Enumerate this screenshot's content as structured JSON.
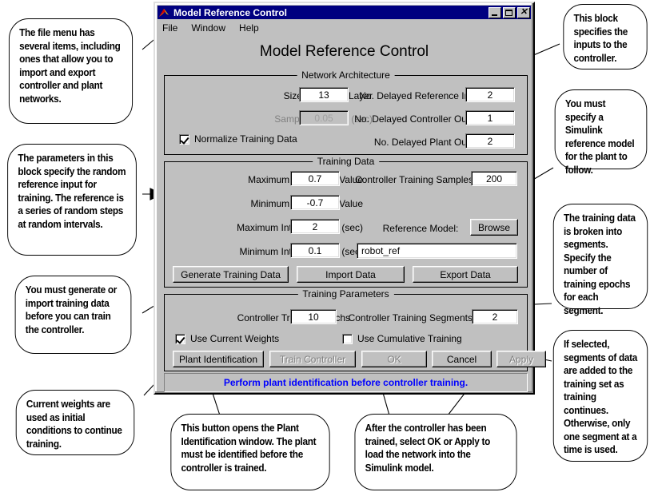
{
  "window": {
    "title": "Model Reference Control",
    "icon": "matlab-membrane-icon",
    "minimize_label": "",
    "maximize_label": "",
    "close_label": "✕",
    "menu": [
      {
        "label": "File"
      },
      {
        "label": "Window"
      },
      {
        "label": "Help"
      }
    ],
    "heading": "Model Reference Control",
    "status_message": "Perform plant identification before controller training.",
    "status_color": "#0000ff"
  },
  "network_architecture": {
    "title": "Network Architecture",
    "size_hidden_layer_label": "Size of Hidden Layer",
    "size_hidden_layer_value": "13",
    "sampling_interval_label": "Sampling Interval (sec)",
    "sampling_interval_value": "0.05",
    "normalize_label": "Normalize Training Data",
    "normalize_checked": true,
    "delayed_reference_inputs_label": "No. Delayed Reference Inputs",
    "delayed_reference_inputs_value": "2",
    "delayed_controller_outputs_label": "No. Delayed Controller Outputs",
    "delayed_controller_outputs_value": "1",
    "delayed_plant_outputs_label": "No. Delayed Plant Outputs",
    "delayed_plant_outputs_value": "2"
  },
  "training_data": {
    "title": "Training Data",
    "max_reference_label": "Maximum Reference Value",
    "max_reference_value": "0.7",
    "min_reference_label": "Minimum Reference Value",
    "min_reference_value": "-0.7",
    "max_interval_label": "Maximum Interval Value (sec)",
    "max_interval_value": "2",
    "min_interval_label": "Minimum Interval Value (sec)",
    "min_interval_value": "0.1",
    "controller_training_samples_label": "Controller Training Samples",
    "controller_training_samples_value": "200",
    "reference_model_label": "Reference Model:",
    "reference_model_value": "robot_ref",
    "browse_label": "Browse",
    "generate_label": "Generate Training Data",
    "import_label": "Import Data",
    "export_label": "Export Data"
  },
  "training_parameters": {
    "title": "Training Parameters",
    "epochs_label": "Controller Training Epochs",
    "epochs_value": "10",
    "segments_label": "Controller Training Segments",
    "segments_value": "2",
    "use_current_weights_label": "Use Current Weights",
    "use_current_weights_checked": true,
    "use_cumulative_label": "Use Cumulative Training",
    "use_cumulative_checked": false,
    "plant_identification_label": "Plant Identification",
    "train_controller_label": "Train Controller",
    "ok_label": "OK",
    "cancel_label": "Cancel",
    "apply_label": "Apply"
  },
  "annotations": [
    {
      "id": "file-menu-note",
      "text": "The file menu has several items, including ones that allow you to import and export controller and plant networks."
    },
    {
      "id": "random-reference-note",
      "text": "The parameters in this block specify the random reference input for training. The reference is a series of random steps at random intervals."
    },
    {
      "id": "training-data-note",
      "text": "You must generate or import training data before you can train the controller."
    },
    {
      "id": "current-weights-note",
      "text": "Current weights are used as initial conditions to continue training."
    },
    {
      "id": "inputs-note",
      "text": "This block specifies the inputs to the controller."
    },
    {
      "id": "reference-model-note",
      "text": "You must specify a Simulink reference model for the plant to follow."
    },
    {
      "id": "segments-note",
      "text": "The training data is broken into segments. Specify the number of training epochs for each segment."
    },
    {
      "id": "cumulative-note",
      "text": "If selected, segments of data are added to the training set as training continues. Otherwise, only one segment at a time is used."
    },
    {
      "id": "plant-button-note",
      "text": "This button opens the Plant Identification window. The plant must be identified before the controller is trained."
    },
    {
      "id": "ok-apply-note_1",
      "text": "After the controller has been trained, select "
    },
    {
      "id": "ok-apply-note_b1",
      "text": "OK"
    },
    {
      "id": "ok-apply-note_2",
      "text": " or "
    },
    {
      "id": "ok-apply-note_b2",
      "text": "Apply"
    },
    {
      "id": "ok-apply-note_3",
      "text": " to load the network into the Simulink model."
    }
  ]
}
